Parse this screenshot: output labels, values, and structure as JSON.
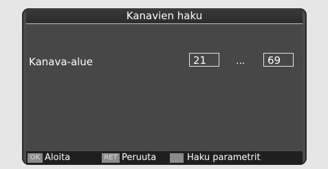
{
  "dialog": {
    "title": "Kanavien haku"
  },
  "range": {
    "label": "Kanava-alue",
    "from": "21",
    "separator": "...",
    "to": "69"
  },
  "footer": {
    "ok_key": "OK",
    "ok_label": "Aloita",
    "ret_key": "RET",
    "ret_label": "Peruuta",
    "params_label": "Haku parametrit"
  }
}
